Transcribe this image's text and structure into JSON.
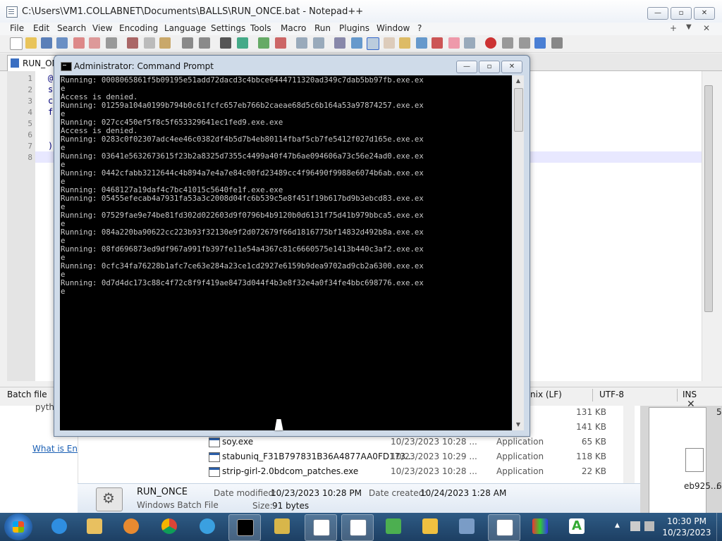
{
  "notepad": {
    "title": "C:\\Users\\VM1.COLLABNET\\Documents\\BALLS\\RUN_ONCE.bat - Notepad++",
    "menu": [
      "File",
      "Edit",
      "Search",
      "View",
      "Encoding",
      "Language",
      "Settings",
      "Tools",
      "Macro",
      "Run",
      "Plugins",
      "Window",
      "?"
    ],
    "menu_extra": {
      "plus": "+",
      "down": "▼",
      "close": "✕"
    },
    "tab_label": "RUN_ON",
    "line_numbers": [
      "1",
      "2",
      "3",
      "4",
      "5",
      "6",
      "7",
      "8"
    ],
    "code_chars": {
      "l1": "@",
      "l2": "s",
      "l3": "c",
      "l4": "f",
      "l7": ")"
    },
    "status": {
      "type": "Batch file",
      "eol": "nix (LF)",
      "encoding": "UTF-8",
      "mode": "INS"
    }
  },
  "cmd": {
    "title": "Administrator: Command Prompt",
    "lines": [
      "Running: 0008065861f5b09195e51add72dacd3c4bbce6444711320ad349c7dab5bb97fb.exe.ex",
      "e",
      "Access is denied.",
      "Running: 01259a104a0199b794b0c61fcfc657eb766b2caeae68d5c6b164a53a97874257.exe.ex",
      "e",
      "Running: 027cc450ef5f8c5f653329641ec1fed9.exe.exe",
      "Access is denied.",
      "Running: 0283c0f02307adc4ee46c0382df4b5d7b4eb80114fbaf5cb7fe5412f027d165e.exe.ex",
      "e",
      "Running: 03641e5632673615f23b2a8325d7355c4499a40f47b6ae094606a73c56e24ad0.exe.ex",
      "e",
      "Running: 0442cfabb3212644c4b894a7e4a7e84c00fd23489cc4f96490f9988e6074b6ab.exe.ex",
      "e",
      "Running: 0468127a19daf4c7bc41015c5640fe1f.exe.exe",
      "Running: 05455efecab4a7931fa53a3c2008d04fc6b539c5e8f451f19b617bd9b3ebcd83.exe.ex",
      "e",
      "Running: 07529fae9e74be81fd302d022603d9f0796b4b9120b0d6131f75d41b979bbca5.exe.ex",
      "e",
      "Running: 084a220ba90622cc223b93f32130e9f2d072679f66d1816775bf14832d492b8a.exe.ex",
      "e",
      "Running: 08fd696873ed9df967a991fb397fe11e54a4367c81c6660575e1413b440c3af2.exe.ex",
      "e",
      "Running: 0cfc34fa76228b1afc7ce63e284a23ce1cd2927e6159b9dea9702ad9cb2a6300.exe.ex",
      "e",
      "Running: 0d7d4dc173c88c4f72c8f9f419ae8473d044f4b3e8f32e4a0f34fe4bbc698776.exe.ex",
      "e"
    ]
  },
  "explorer": {
    "left_partial": "pyth",
    "link": "What is En",
    "rows": [
      {
        "name": "",
        "date": "",
        "type": "",
        "size": "131 KB"
      },
      {
        "name": "",
        "date": "",
        "type": "",
        "size": "141 KB"
      },
      {
        "name": "soy.exe",
        "date": "10/23/2023 10:28 ...",
        "type": "Application",
        "size": "65 KB"
      },
      {
        "name": "stabuniq_F31B797831B36A4877AA0FD173...",
        "date": "10/23/2023 10:29 ...",
        "type": "Application",
        "size": "118 KB"
      },
      {
        "name": "strip-girl-2.0bdcom_patches.exe",
        "date": "10/23/2023 10:28 ...",
        "type": "Application",
        "size": "22 KB"
      }
    ],
    "details": {
      "name": "RUN_ONCE",
      "type": "Windows Batch File",
      "modified_label": "Date modified:",
      "modified": "10/23/2023 10:28 PM",
      "created_label": "Date created:",
      "created": "10/24/2023 1:28 AM",
      "size_label": "Size:",
      "size": "91 bytes"
    }
  },
  "right_window": {
    "x": "✕",
    "a": "5",
    "b": "eb925...",
    "c": "6"
  },
  "taskbar": {
    "items": [
      "internet-explorer",
      "file-explorer",
      "media-player",
      "chrome",
      "network-app",
      "command-prompt",
      "keys-app",
      "notepad-window-1",
      "notepad-window-2",
      "puzzle-app",
      "calculator",
      "network-tool",
      "notepad-window-3",
      "monitor-app",
      "font-app"
    ],
    "time": "10:30 PM",
    "date": "10/23/2023"
  },
  "colors": {
    "cmd_text": "#c8c8c8",
    "cmd_bg": "#000000",
    "taskbar": "#1d3f63"
  }
}
